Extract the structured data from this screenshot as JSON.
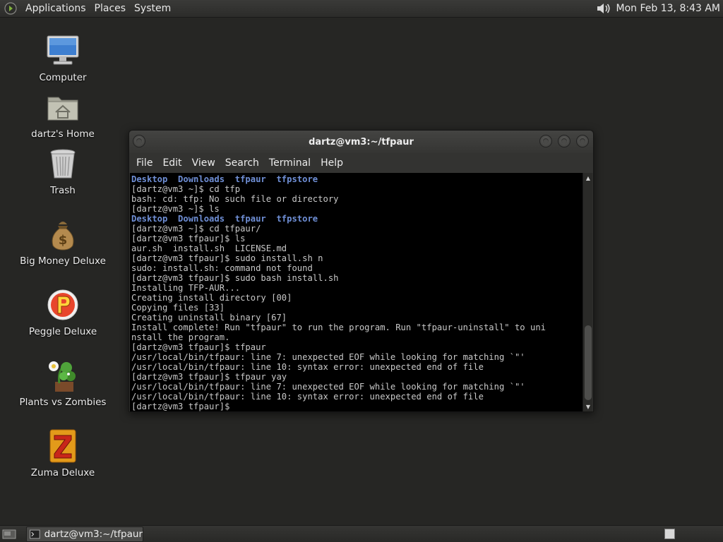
{
  "top_panel": {
    "menus": [
      "Applications",
      "Places",
      "System"
    ],
    "clock": "Mon Feb 13,  8:43 AM",
    "logo_icon": "gnome-foot-icon",
    "volume_icon": "speaker-icon"
  },
  "desktop": {
    "icons": [
      {
        "label": "Computer",
        "icon": "computer-icon"
      },
      {
        "label": "dartz's Home",
        "icon": "home-folder-icon"
      },
      {
        "label": "Trash",
        "icon": "trash-icon"
      },
      {
        "label": "Big Money Deluxe",
        "icon": "money-bag-icon"
      },
      {
        "label": "Peggle Deluxe",
        "icon": "peggle-icon"
      },
      {
        "label": "Plants vs Zombies",
        "icon": "plants-icon"
      },
      {
        "label": "Zuma Deluxe",
        "icon": "zuma-icon"
      }
    ]
  },
  "terminal": {
    "title": "dartz@vm3:~/tfpaur",
    "menu": [
      "File",
      "Edit",
      "View",
      "Search",
      "Terminal",
      "Help"
    ],
    "lines": [
      "Desktop  Downloads  tfpaur  tfpstore",
      "[dartz@vm3 ~]$ cd tfp",
      "bash: cd: tfp: No such file or directory",
      "[dartz@vm3 ~]$ ls",
      "Desktop  Downloads  tfpaur  tfpstore",
      "[dartz@vm3 ~]$ cd tfpaur/",
      "[dartz@vm3 tfpaur]$ ls",
      "aur.sh  install.sh  LICENSE.md",
      "[dartz@vm3 tfpaur]$ sudo install.sh n",
      "sudo: install.sh: command not found",
      "[dartz@vm3 tfpaur]$ sudo bash install.sh",
      "Installing TFP-AUR...",
      "Creating install directory [00]",
      "Copying files [33]",
      "Creating uninstall binary [67]",
      "Install complete! Run \"tfpaur\" to run the program. Run \"tfpaur-uninstall\" to uni",
      "nstall the program.",
      "[dartz@vm3 tfpaur]$ tfpaur",
      "/usr/local/bin/tfpaur: line 7: unexpected EOF while looking for matching `\"'",
      "/usr/local/bin/tfpaur: line 10: syntax error: unexpected end of file",
      "[dartz@vm3 tfpaur]$ tfpaur yay",
      "/usr/local/bin/tfpaur: line 7: unexpected EOF while looking for matching `\"'",
      "/usr/local/bin/tfpaur: line 10: syntax error: unexpected end of file",
      "[dartz@vm3 tfpaur]$ "
    ],
    "colors": {
      "dirs": "#6f8fd6",
      "text": "#c8c8c8",
      "background": "#000000"
    }
  },
  "bottom_panel": {
    "task_label": "dartz@vm3:~/tfpaur",
    "show_desktop_icon": "show-desktop-icon",
    "task_icon": "terminal-icon"
  }
}
